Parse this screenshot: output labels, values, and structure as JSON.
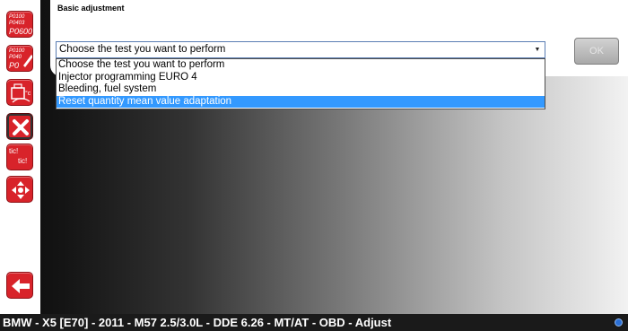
{
  "sidebar": {
    "fault_codes_primary": [
      "P0100",
      "P0403",
      "P0600"
    ],
    "fault_codes_secondary": [
      "P0100",
      "P040",
      "P0"
    ],
    "test_badge_text": [
      "tic!",
      "tic!"
    ],
    "items": [
      {
        "name": "fault-memory",
        "icon": "fault-codes-icon"
      },
      {
        "name": "fault-memory-delete",
        "icon": "fault-codes-erase-icon"
      },
      {
        "name": "diagnostics",
        "icon": "engine-diagnostics-icon"
      },
      {
        "name": "adjustments",
        "icon": "tools-icon",
        "selected": true
      },
      {
        "name": "actuator-tests",
        "icon": "tic-test-icon"
      },
      {
        "name": "service",
        "icon": "cycle-arrows-icon"
      },
      {
        "name": "back",
        "icon": "back-arrow-icon"
      }
    ]
  },
  "panel": {
    "title": "Basic adjustment",
    "select_value": "Choose the test you want to perform",
    "ok_label": "OK"
  },
  "dropdown": {
    "options": [
      "Choose the test you want to perform",
      "Injector programming EURO 4",
      "Bleeding, fuel system",
      "Reset quantity mean value adaptation"
    ],
    "highlighted_index": 3
  },
  "status_bar": {
    "text": "BMW - X5 [E70] - 2011 - M57 2.5/3.0L - DDE 6.26 - MT/AT - OBD - Adjust"
  },
  "colors": {
    "accent_red": "#d8232a",
    "highlight_blue": "#3399ff",
    "status_bar_bg": "#1a1a1a"
  }
}
